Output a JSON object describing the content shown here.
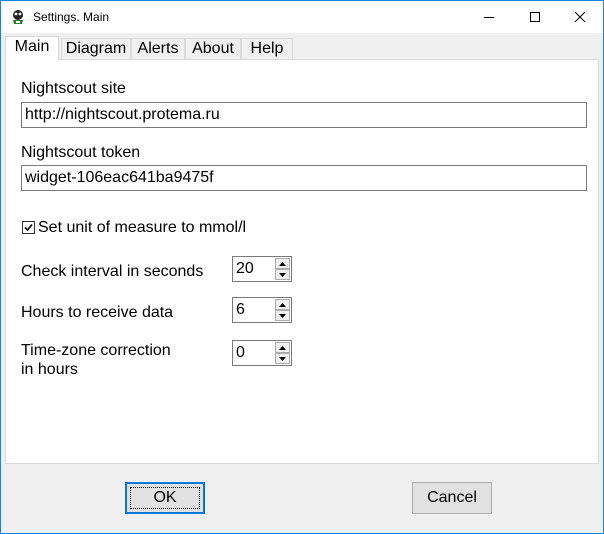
{
  "window": {
    "title": "Settings. Main"
  },
  "tabs": [
    {
      "label": "Main"
    },
    {
      "label": "Diagram"
    },
    {
      "label": "Alerts"
    },
    {
      "label": "About"
    },
    {
      "label": "Help"
    }
  ],
  "main": {
    "site_label": "Nightscout site",
    "site_value": "http://nightscout.protema.ru",
    "token_label": "Nightscout token",
    "token_value": "widget-106eac641ba9475f",
    "unit_checkbox_label": "Set unit of measure to mmol/l",
    "unit_checked": true,
    "check_interval_label": "Check interval in seconds",
    "check_interval_value": "20",
    "hours_label": "Hours to receive data",
    "hours_value": "6",
    "tz_label_line1": "Time-zone correction",
    "tz_label_line2": "in hours",
    "tz_value": "0"
  },
  "buttons": {
    "ok": "OK",
    "cancel": "Cancel"
  },
  "colors": {
    "accent": "#0078d7",
    "window_border": "#1883d7",
    "face": "#f0f0f0"
  }
}
